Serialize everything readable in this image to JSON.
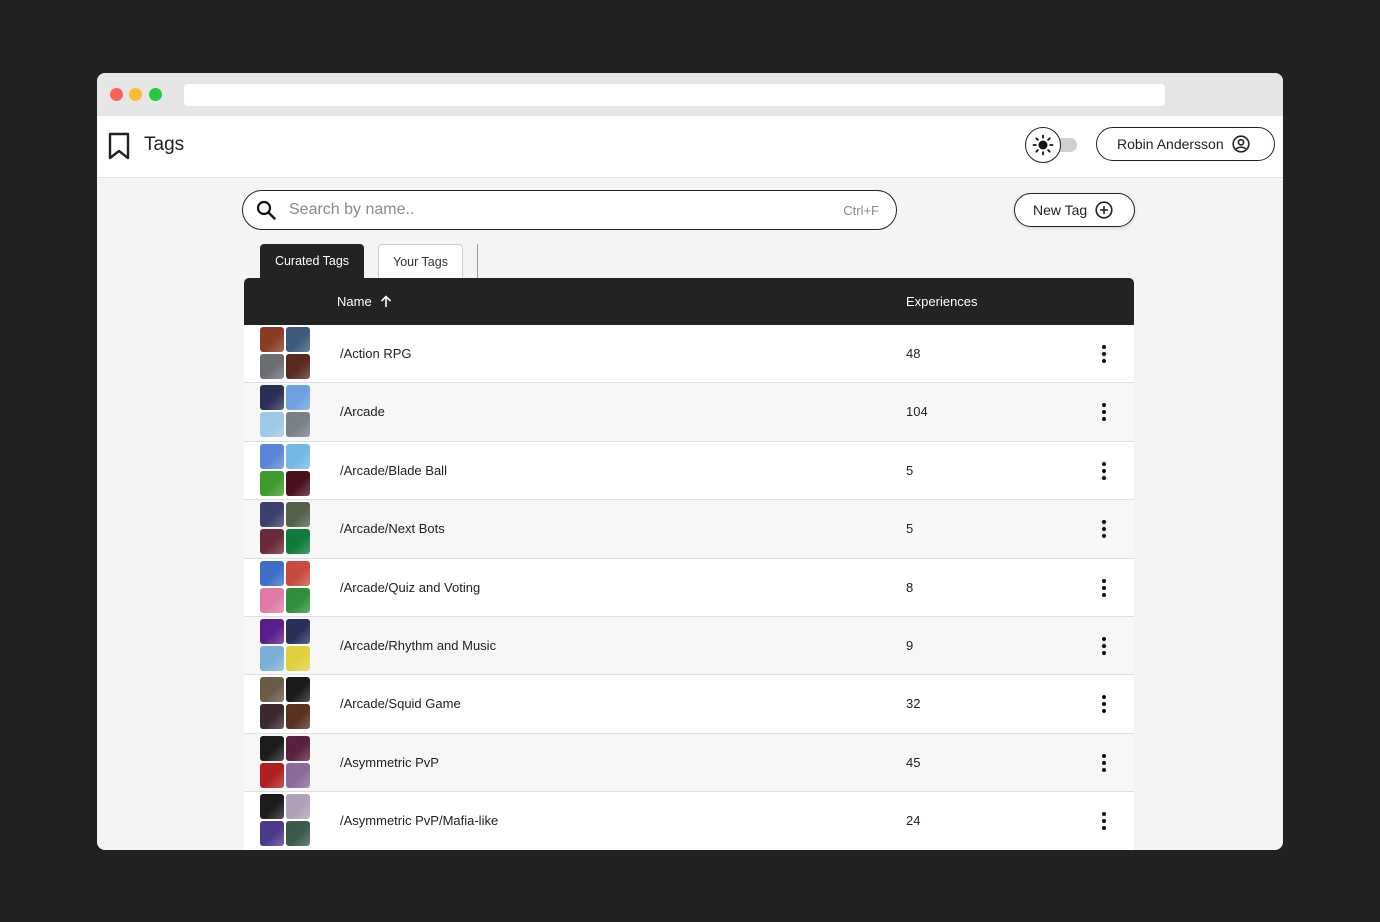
{
  "app": {
    "title": "Tags"
  },
  "user": {
    "name": "Robin Andersson"
  },
  "search": {
    "placeholder": "Search by name..",
    "value": "",
    "shortcut": "Ctrl+F"
  },
  "actions": {
    "new_tag_label": "New Tag"
  },
  "tabs": [
    {
      "label": "Curated Tags",
      "active": true
    },
    {
      "label": "Your Tags",
      "active": false
    }
  ],
  "table": {
    "columns": {
      "name": "Name",
      "experiences": "Experiences"
    },
    "sort": {
      "column": "Name",
      "direction": "ascending"
    },
    "rows": [
      {
        "name": "/Action RPG",
        "experiences": "48",
        "thumbs": [
          "#8a3b24",
          "#3d5a7a",
          "#6b6f74",
          "#5a2a1e"
        ]
      },
      {
        "name": "/Arcade",
        "experiences": "104",
        "thumbs": [
          "#2b2f55",
          "#6fa0e0",
          "#9fc7e6",
          "#7a8088"
        ]
      },
      {
        "name": "/Arcade/Blade Ball",
        "experiences": "5",
        "thumbs": [
          "#5a86d8",
          "#73b9e8",
          "#3f9a2c",
          "#4a1020"
        ]
      },
      {
        "name": "/Arcade/Next Bots",
        "experiences": "5",
        "thumbs": [
          "#3a3f6b",
          "#55604a",
          "#6a2a3a",
          "#0f7a3a"
        ]
      },
      {
        "name": "/Arcade/Quiz and Voting",
        "experiences": "8",
        "thumbs": [
          "#3d6fc8",
          "#c84b3d",
          "#e07aa8",
          "#2f8f3a"
        ]
      },
      {
        "name": "/Arcade/Rhythm and Music",
        "experiences": "9",
        "thumbs": [
          "#5a1e8a",
          "#2a2f5a",
          "#7ab0d6",
          "#e0d040"
        ]
      },
      {
        "name": "/Arcade/Squid Game",
        "experiences": "32",
        "thumbs": [
          "#6a5a48",
          "#1a1a1a",
          "#3a2a30",
          "#5a3020"
        ]
      },
      {
        "name": "/Asymmetric PvP",
        "experiences": "45",
        "thumbs": [
          "#1c1c1c",
          "#5a2040",
          "#b02020",
          "#8a6a9a"
        ]
      },
      {
        "name": "/Asymmetric PvP/Mafia-like",
        "experiences": "24",
        "thumbs": [
          "#1c1c1c",
          "#b0a0b8",
          "#4a3a8a",
          "#3a5a4a"
        ]
      }
    ]
  },
  "colors": {
    "header_bg": "#232323",
    "page_bg": "#f3f4f3",
    "outer_bg": "#212121"
  }
}
